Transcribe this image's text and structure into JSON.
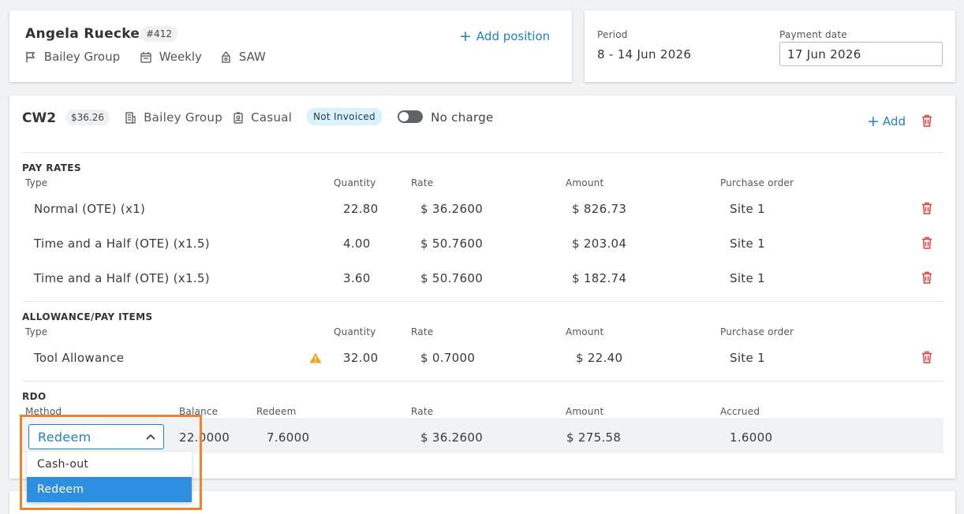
{
  "employee": {
    "name": "Angela Ruecker",
    "id_badge": "#412",
    "company": "Bailey Group",
    "frequency": "Weekly",
    "state": "SAW",
    "add_position_label": "Add position"
  },
  "period": {
    "period_label": "Period",
    "period_value": "8 - 14 Jun 2026",
    "payment_date_label": "Payment date",
    "payment_date_value": "17 Jun 2026"
  },
  "position": {
    "code": "CW2",
    "rate_badge": "$36.26",
    "company": "Bailey Group",
    "employment_type": "Casual",
    "status_badge": "Not Invoiced",
    "no_charge_label": "No charge",
    "no_charge_on": false,
    "add_label": "Add"
  },
  "pay_rates": {
    "title": "PAY RATES",
    "headers": {
      "type": "Type",
      "quantity": "Quantity",
      "rate": "Rate",
      "amount": "Amount",
      "po": "Purchase order"
    },
    "rows": [
      {
        "type": "Normal (OTE) (x1)",
        "quantity": "22.80",
        "rate": "$ 36.2600",
        "amount": "$ 826.73",
        "po": "Site 1"
      },
      {
        "type": "Time and a Half (OTE) (x1.5)",
        "quantity": "4.00",
        "rate": "$ 50.7600",
        "amount": "$ 203.04",
        "po": "Site 1"
      },
      {
        "type": "Time and a Half (OTE) (x1.5)",
        "quantity": "3.60",
        "rate": "$ 50.7600",
        "amount": "$ 182.74",
        "po": "Site 1"
      }
    ]
  },
  "allowances": {
    "title": "ALLOWANCE/PAY ITEMS",
    "headers": {
      "type": "Type",
      "quantity": "Quantity",
      "rate": "Rate",
      "amount": "Amount",
      "po": "Purchase order"
    },
    "rows": [
      {
        "type": "Tool Allowance",
        "quantity": "32.00",
        "rate": "$ 0.7000",
        "amount": "$ 22.40",
        "po": "Site 1",
        "warning": true
      }
    ]
  },
  "rdo": {
    "title": "RDO",
    "headers": {
      "method": "Method",
      "balance": "Balance",
      "redeem": "Redeem",
      "rate": "Rate",
      "amount": "Amount",
      "accrued": "Accrued"
    },
    "row": {
      "method": "Redeem",
      "balance": "22.0000",
      "redeem": "7.6000",
      "rate": "$ 36.2600",
      "amount": "$ 275.58",
      "accrued": "1.6000"
    },
    "dropdown_options": [
      "Cash-out",
      "Redeem"
    ],
    "selected_option": "Redeem"
  },
  "colors": {
    "accent": "#1f7fd0",
    "danger": "#e53935",
    "highlight_box": "#f0832a",
    "status_badge_bg": "#d9f1fb",
    "selected_option_bg": "#2e8fe0"
  },
  "icons": [
    "flag-icon",
    "calendar-icon",
    "location-icon",
    "building-icon",
    "id-badge-icon",
    "plus-icon",
    "trash-icon",
    "warning-icon",
    "chevron-up-icon",
    "toggle-switch"
  ]
}
